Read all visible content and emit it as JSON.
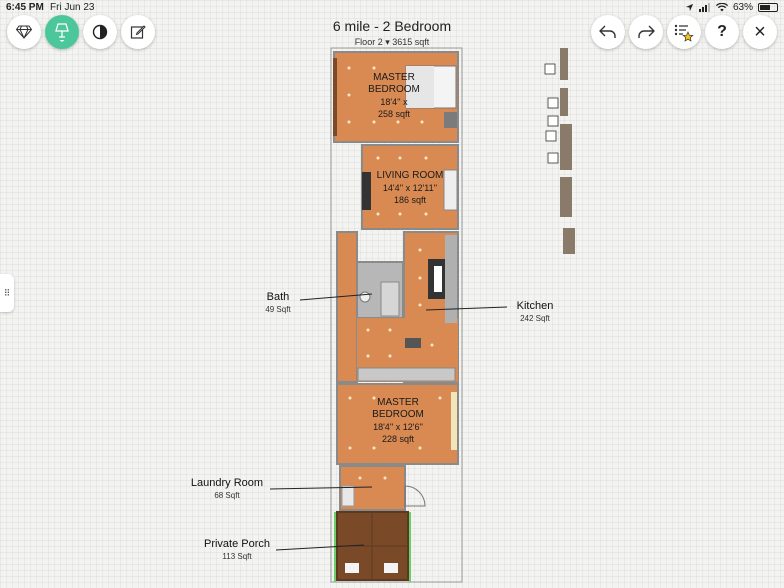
{
  "status_bar": {
    "time": "6:45 PM",
    "date": "Fri Jun 23",
    "battery": "63%",
    "battery_level": 0.63
  },
  "header": {
    "title": "6 mile - 2 Bedroom",
    "floor_label": "Floor 2",
    "floor_area": "3615 sqft"
  },
  "toolbar_left": [
    {
      "name": "diamond-icon",
      "active": false
    },
    {
      "name": "lamp-icon",
      "active": true
    },
    {
      "name": "contrast-icon",
      "active": false
    },
    {
      "name": "edit-icon",
      "active": false
    }
  ],
  "toolbar_right": [
    {
      "name": "undo-icon"
    },
    {
      "name": "redo-icon"
    },
    {
      "name": "list-star-icon"
    },
    {
      "name": "help-icon",
      "glyph": "?"
    },
    {
      "name": "close-icon",
      "glyph": "×"
    }
  ],
  "rooms": {
    "master_top": {
      "line1": "MASTER",
      "line2": "BEDROOM",
      "dims": "18'4''  x",
      "area": "258 sqft"
    },
    "living": {
      "line1": "LIVING ROOM",
      "dims": "14'4''  x  12'11''",
      "area": "186 sqft"
    },
    "master_bottom": {
      "line1": "MASTER",
      "line2": "BEDROOM",
      "dims": "18'4''  x  12'6''",
      "area": "228 sqft"
    }
  },
  "callouts": {
    "bath": {
      "name": "Bath",
      "size": "49 Sqft"
    },
    "kitchen": {
      "name": "Kitchen",
      "size": "242 Sqft"
    },
    "laundry": {
      "name": "Laundry Room",
      "size": "68 Sqft"
    },
    "porch": {
      "name": "Private Porch",
      "size": "113 Sqft"
    }
  },
  "colors": {
    "accent": "#4cc79a",
    "floor": "#d88a52",
    "wall": "#8a8a8a",
    "porch": "#7a4a28"
  }
}
